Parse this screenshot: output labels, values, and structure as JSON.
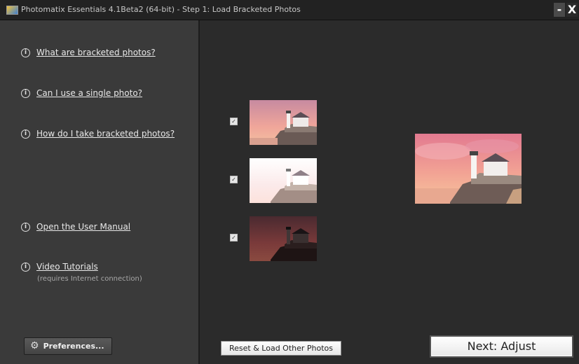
{
  "window": {
    "title": "Photomatix Essentials  4.1Beta2 (64-bit) - Step 1: Load Bracketed Photos",
    "minimize_label": "-",
    "close_label": "X"
  },
  "sidebar": {
    "help_links": [
      {
        "icon": "info-icon",
        "label": "What are bracketed photos?"
      },
      {
        "icon": "info-icon",
        "label": "Can I use a single photo?"
      },
      {
        "icon": "info-icon",
        "label": "How do I take bracketed photos?"
      },
      {
        "icon": "info-icon",
        "label": "Open the User Manual"
      },
      {
        "icon": "info-icon",
        "label": "Video Tutorials"
      }
    ],
    "video_note": "(requires Internet connection)",
    "info_glyph": "i",
    "preferences_label": "Preferences..."
  },
  "bracketed_photos": [
    {
      "checked": true,
      "exposure": "normal"
    },
    {
      "checked": true,
      "exposure": "overexposed"
    },
    {
      "checked": true,
      "exposure": "underexposed"
    }
  ],
  "buttons": {
    "reset_label": "Reset & Load Other Photos",
    "next_label": "Next: Adjust"
  },
  "colors": {
    "sidebar_bg": "#3a3a3a",
    "main_bg": "#2b2b2b",
    "titlebar_bg": "#222222",
    "sky_pink": "#e98aa0",
    "rocks": "#6a5a55"
  }
}
